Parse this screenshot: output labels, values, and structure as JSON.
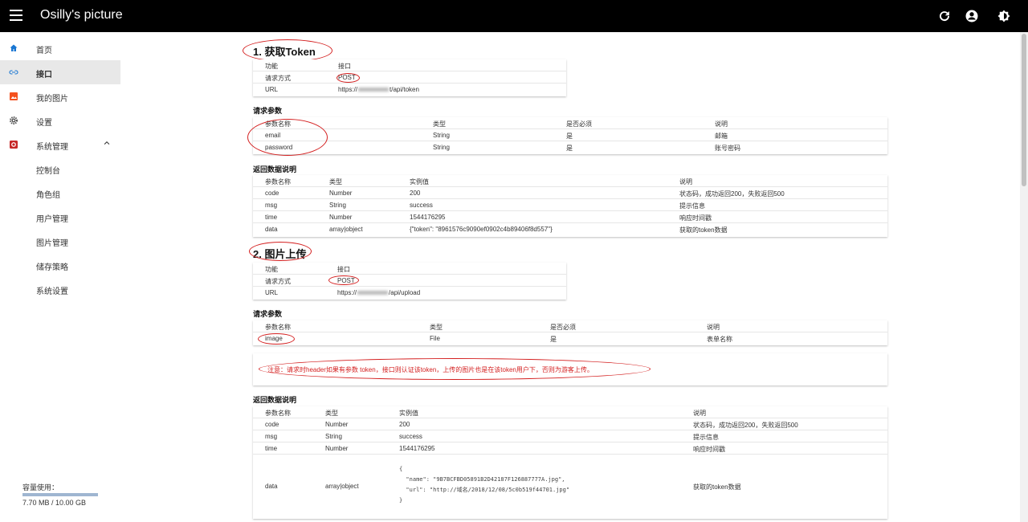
{
  "app": {
    "title": "Osilly's picture"
  },
  "colors": {
    "accent": "#1976d2",
    "annotation": "#d42020",
    "topbar": "#000000"
  },
  "topbar_icons": [
    "refresh-icon",
    "account-icon",
    "theme-icon"
  ],
  "sidebar": {
    "items": [
      {
        "label": "首页",
        "icon": "home-icon"
      },
      {
        "label": "接口",
        "icon": "link-icon"
      },
      {
        "label": "我的图片",
        "icon": "image-icon"
      },
      {
        "label": "设置",
        "icon": "gear-icon"
      },
      {
        "label": "系统管理",
        "icon": "admin-icon"
      },
      {
        "label": "控制台"
      },
      {
        "label": "角色组"
      },
      {
        "label": "用户管理"
      },
      {
        "label": "图片管理"
      },
      {
        "label": "储存策略"
      },
      {
        "label": "系统设置"
      }
    ],
    "active": "接口",
    "storage": {
      "label": "容量使用：",
      "value": "7.70 MB / 10.00 GB",
      "fraction": 0.00077
    }
  },
  "section1": {
    "title": "1. 获取Token",
    "info": {
      "rows": [
        [
          "功能",
          "接口"
        ],
        [
          "请求方式",
          "POST"
        ],
        [
          "URL",
          "https://",
          "t/api/token"
        ]
      ]
    },
    "params_title": "请求参数",
    "params": {
      "headers": [
        "参数名称",
        "类型",
        "是否必须",
        "说明"
      ],
      "rows": [
        [
          "email",
          "String",
          "是",
          "邮箱"
        ],
        [
          "password",
          "String",
          "是",
          "账号密码"
        ]
      ]
    },
    "return_title": "返回数据说明",
    "return": {
      "headers": [
        "参数名称",
        "类型",
        "实例值",
        "说明"
      ],
      "rows": [
        [
          "code",
          "Number",
          "200",
          "状态码，成功返回200，失败返回500"
        ],
        [
          "msg",
          "String",
          "success",
          "提示信息"
        ],
        [
          "time",
          "Number",
          "1544176295",
          "响应时间戳"
        ],
        [
          "data",
          "array|object",
          "{\"token\": \"8961576c9090ef0902c4b89406f8d557\"}",
          "获取的token数据"
        ]
      ]
    }
  },
  "section2": {
    "title": "2. 图片上传",
    "info": {
      "rows": [
        [
          "功能",
          "接口"
        ],
        [
          "请求方式",
          "POST"
        ],
        [
          "URL",
          "https://",
          "/api/upload"
        ]
      ]
    },
    "params_title": "请求参数",
    "params": {
      "headers": [
        "参数名称",
        "类型",
        "是否必须",
        "说明"
      ],
      "rows": [
        [
          "image",
          "File",
          "是",
          "表单名称"
        ]
      ]
    },
    "note": "注意：请求时header如果有参数 token，接口则认证该token，上传的图片也是在该token用户下，否则为游客上传。",
    "return_title": "返回数据说明",
    "return": {
      "headers": [
        "参数名称",
        "类型",
        "实例值",
        "说明"
      ],
      "rows": [
        [
          "code",
          "Number",
          "200",
          "状态码，成功返回200，失败返回500"
        ],
        [
          "msg",
          "String",
          "success",
          "提示信息"
        ],
        [
          "time",
          "Number",
          "1544176295",
          "响应时间戳"
        ]
      ],
      "data_row": {
        "name": "data",
        "type": "array|object",
        "json_lines": [
          "{",
          "  \"name\": \"9B7BCFBD05891B2D42187F126887777A.jpg\",",
          "  \"url\": \"http://域名/2018/12/08/5c0b519f44701.jpg\"",
          "}"
        ],
        "desc": "获取的token数据"
      }
    }
  }
}
